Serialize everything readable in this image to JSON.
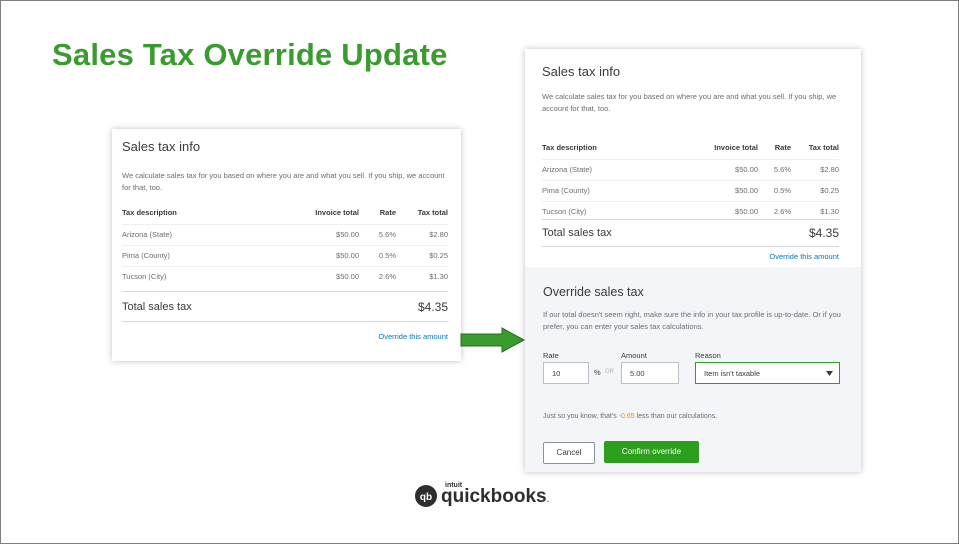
{
  "slide": {
    "title": "Sales Tax Override Update"
  },
  "sales_tax_info": {
    "heading": "Sales tax info",
    "description": "We calculate sales tax for you based on where you are and what you sell. If you ship, we account for that, too.",
    "columns": [
      "Tax description",
      "Invoice total",
      "Rate",
      "Tax total"
    ],
    "rows": [
      [
        "Arizona (State)",
        "$50.00",
        "5.6%",
        "$2.80"
      ],
      [
        "Pima (County)",
        "$50.00",
        "0.5%",
        "$0.25"
      ],
      [
        "Tucson (City)",
        "$50.00",
        "2.6%",
        "$1.30"
      ]
    ],
    "total_label": "Total sales tax",
    "total_value": "$4.35",
    "override_link": "Override this amount"
  },
  "override_panel": {
    "heading": "Override sales tax",
    "description": "If our total doesn't seem right, make sure the info in your tax profile is up-to-date. Or if you prefer, you can enter your sales tax calculations.",
    "rate_label": "Rate",
    "rate_value": "10",
    "percent_sign": "%",
    "or_text": "OR",
    "amount_label": "Amount",
    "amount_value": "5.00",
    "reason_label": "Reason",
    "reason_value": "Item isn't taxable",
    "notice_prefix": "Just so you know, that's",
    "notice_amount": "-0.65",
    "notice_suffix": "less than our calculations.",
    "cancel_label": "Cancel",
    "confirm_label": "Confirm override"
  },
  "logo": {
    "brand_top": "intuit",
    "brand_name": "quickbooks",
    "brand_dot": "."
  },
  "colors": {
    "title_green": "#3a9b2f",
    "qb_green": "#2ca01c",
    "link_blue": "#0077c5",
    "notice_orange": "#ff8000"
  },
  "icons": {
    "arrow": "green-right-arrow",
    "dropdown": "caret-down-icon",
    "logo": "quickbooks-logo-icon"
  }
}
